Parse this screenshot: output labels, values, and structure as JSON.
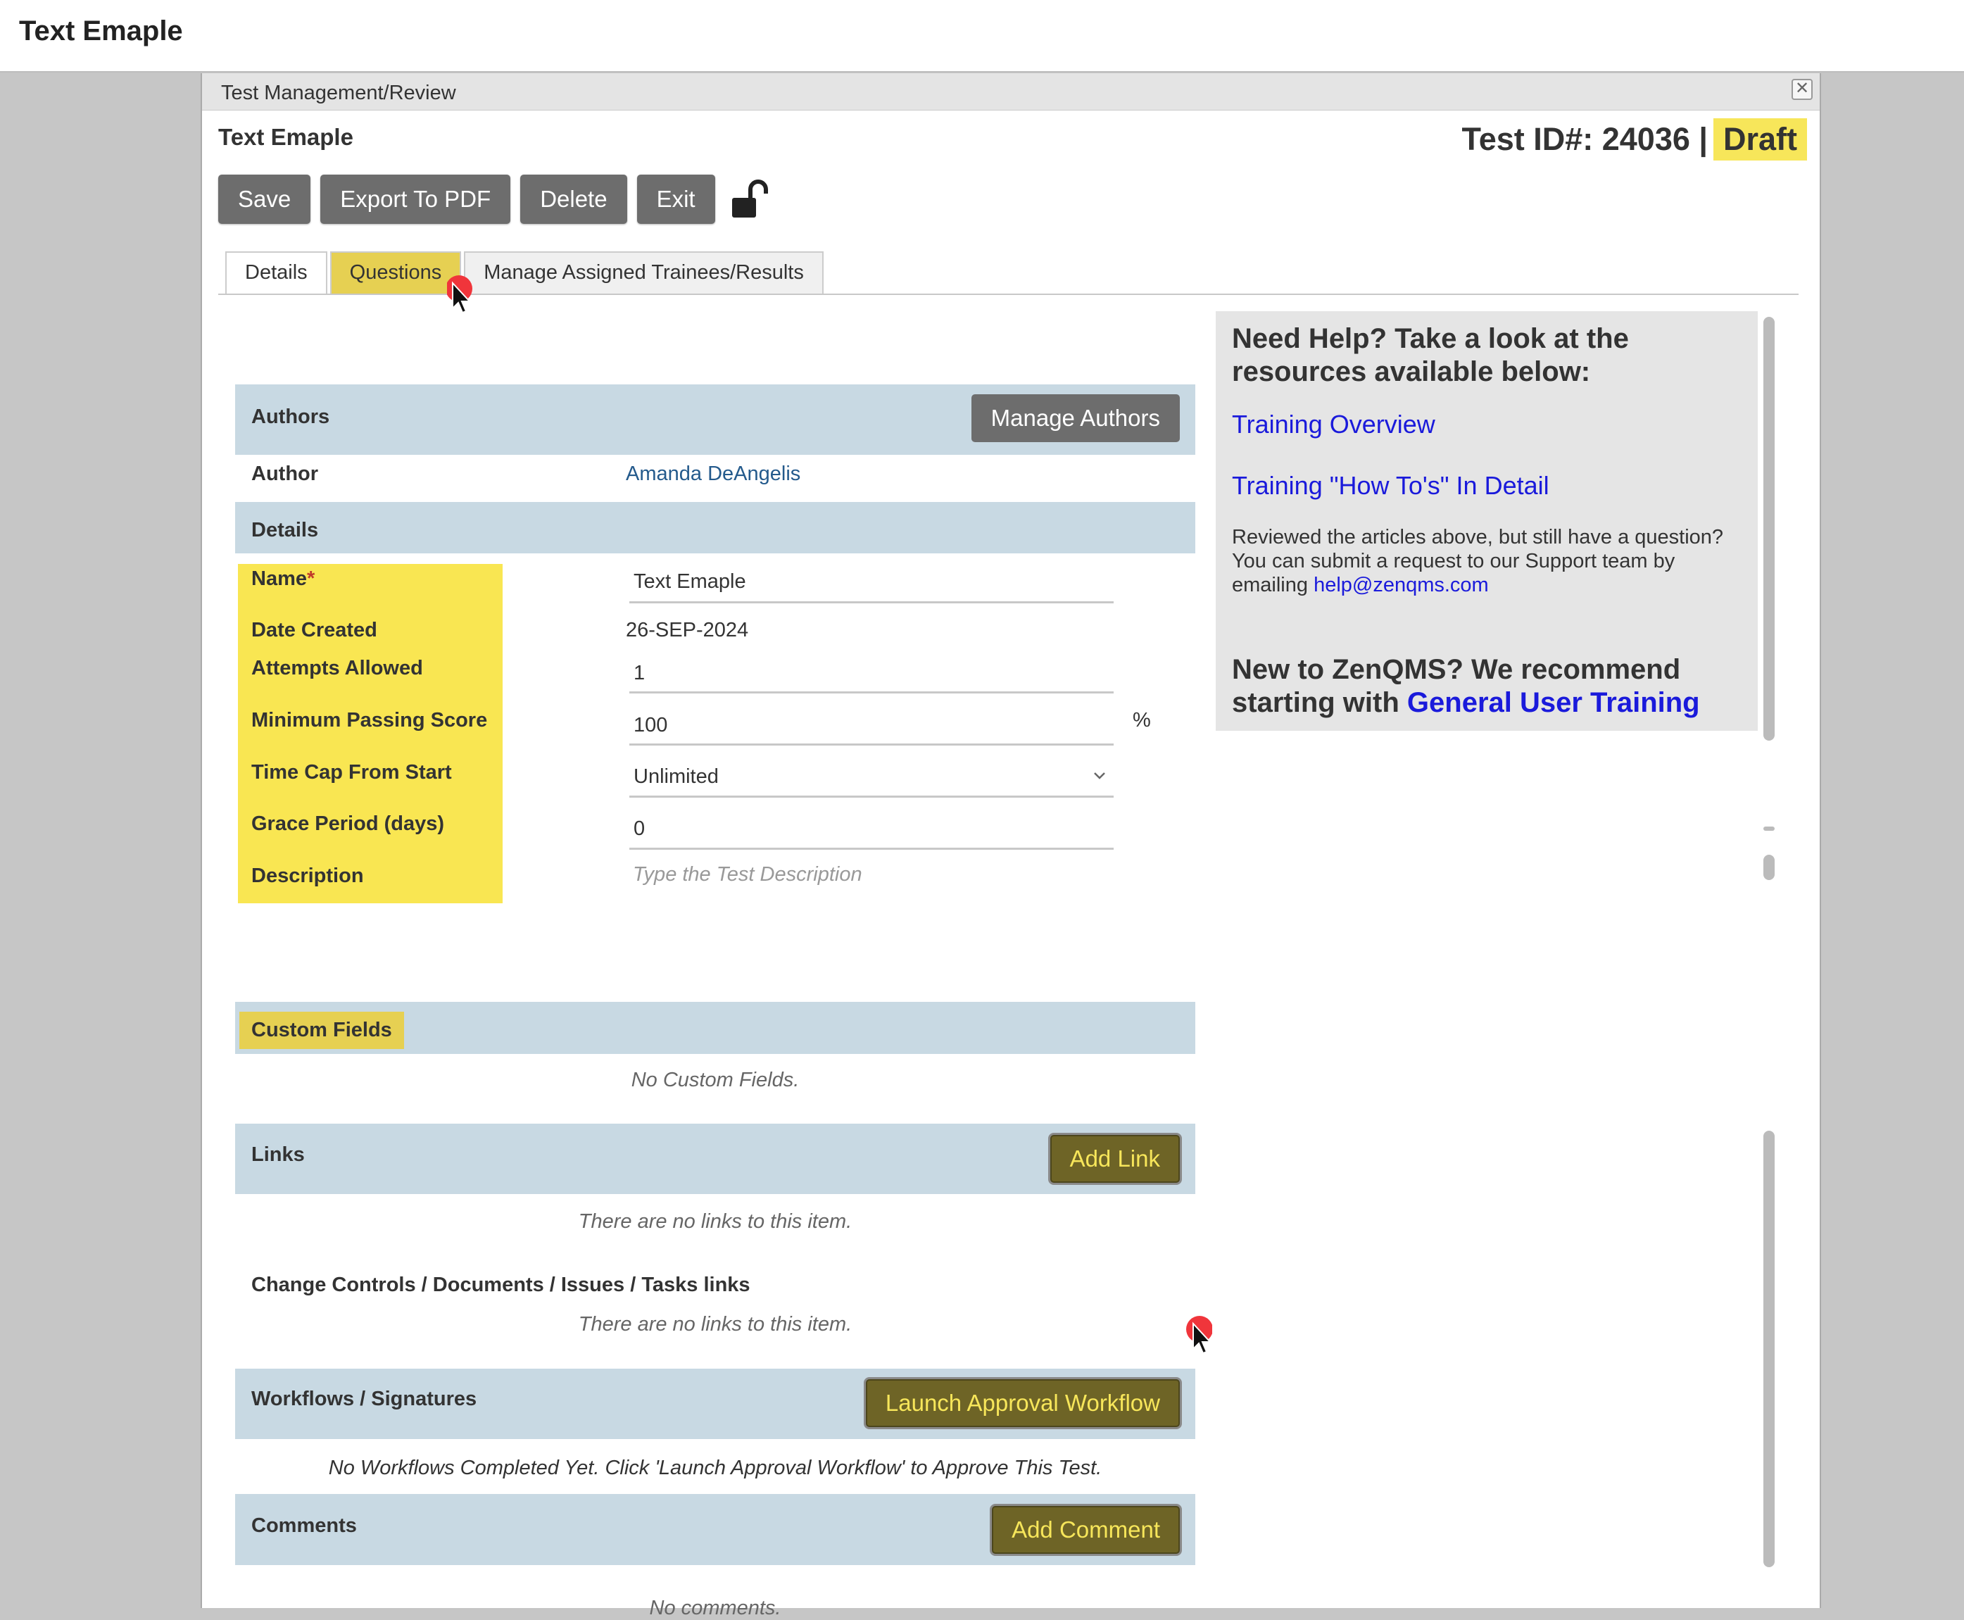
{
  "page": {
    "title": "Text Emaple"
  },
  "modal": {
    "title": "Test Management/Review",
    "close_glyph": "✕",
    "test_name": "Text Emaple",
    "test_id_label": "Test ID#: 24036 |",
    "status": "Draft"
  },
  "toolbar": {
    "save": "Save",
    "export": "Export To PDF",
    "delete": "Delete",
    "exit": "Exit",
    "lock_icon": "unlocked-padlock"
  },
  "tabs": [
    {
      "label": "Details"
    },
    {
      "label": "Questions"
    },
    {
      "label": "Manage Assigned Trainees/Results"
    }
  ],
  "authors": {
    "header": "Authors",
    "manage_button": "Manage Authors",
    "author_label": "Author",
    "author_name": "Amanda DeAngelis"
  },
  "details": {
    "header": "Details",
    "name_label": "Name",
    "required_mark": "*",
    "name_value": "Text Emaple",
    "date_label": "Date Created",
    "date_value": "26-SEP-2024",
    "attempts_label": "Attempts Allowed",
    "attempts_value": "1",
    "min_score_label": "Minimum Passing Score",
    "min_score_value": "100",
    "percent": "%",
    "time_cap_label": "Time Cap From Start",
    "time_cap_value": "Unlimited",
    "grace_label": "Grace Period (days)",
    "grace_value": "0",
    "description_label": "Description",
    "description_placeholder": "Type the Test Description"
  },
  "custom_fields": {
    "header": "Custom Fields",
    "empty": "No Custom Fields."
  },
  "links": {
    "header": "Links",
    "add_button": "Add Link",
    "empty": "There are no links to this item.",
    "cc_header": "Change Controls / Documents / Issues / Tasks links",
    "cc_empty": "There are no links to this item."
  },
  "workflows": {
    "header": "Workflows / Signatures",
    "launch_button": "Launch Approval Workflow",
    "empty": "No Workflows Completed Yet. Click 'Launch Approval Workflow' to Approve This Test."
  },
  "comments": {
    "header": "Comments",
    "add_button": "Add Comment",
    "empty": "No comments."
  },
  "help": {
    "heading": "Need Help? Take a look at the resources available below:",
    "link1": "Training Overview",
    "link2": "Training \"How To's\" In Detail",
    "text": "Reviewed the articles above, but still have a question? You can submit a request to our Support team by emailing",
    "email": "help@zenqms.com",
    "new_text": "New to ZenQMS? We recommend starting with",
    "new_link": "General User Training"
  },
  "colors": {
    "highlight_yellow": "#f9e652",
    "section_blue": "#c8d9e3",
    "olive_button": "#6e6426",
    "link_blue": "#1a1adb"
  }
}
